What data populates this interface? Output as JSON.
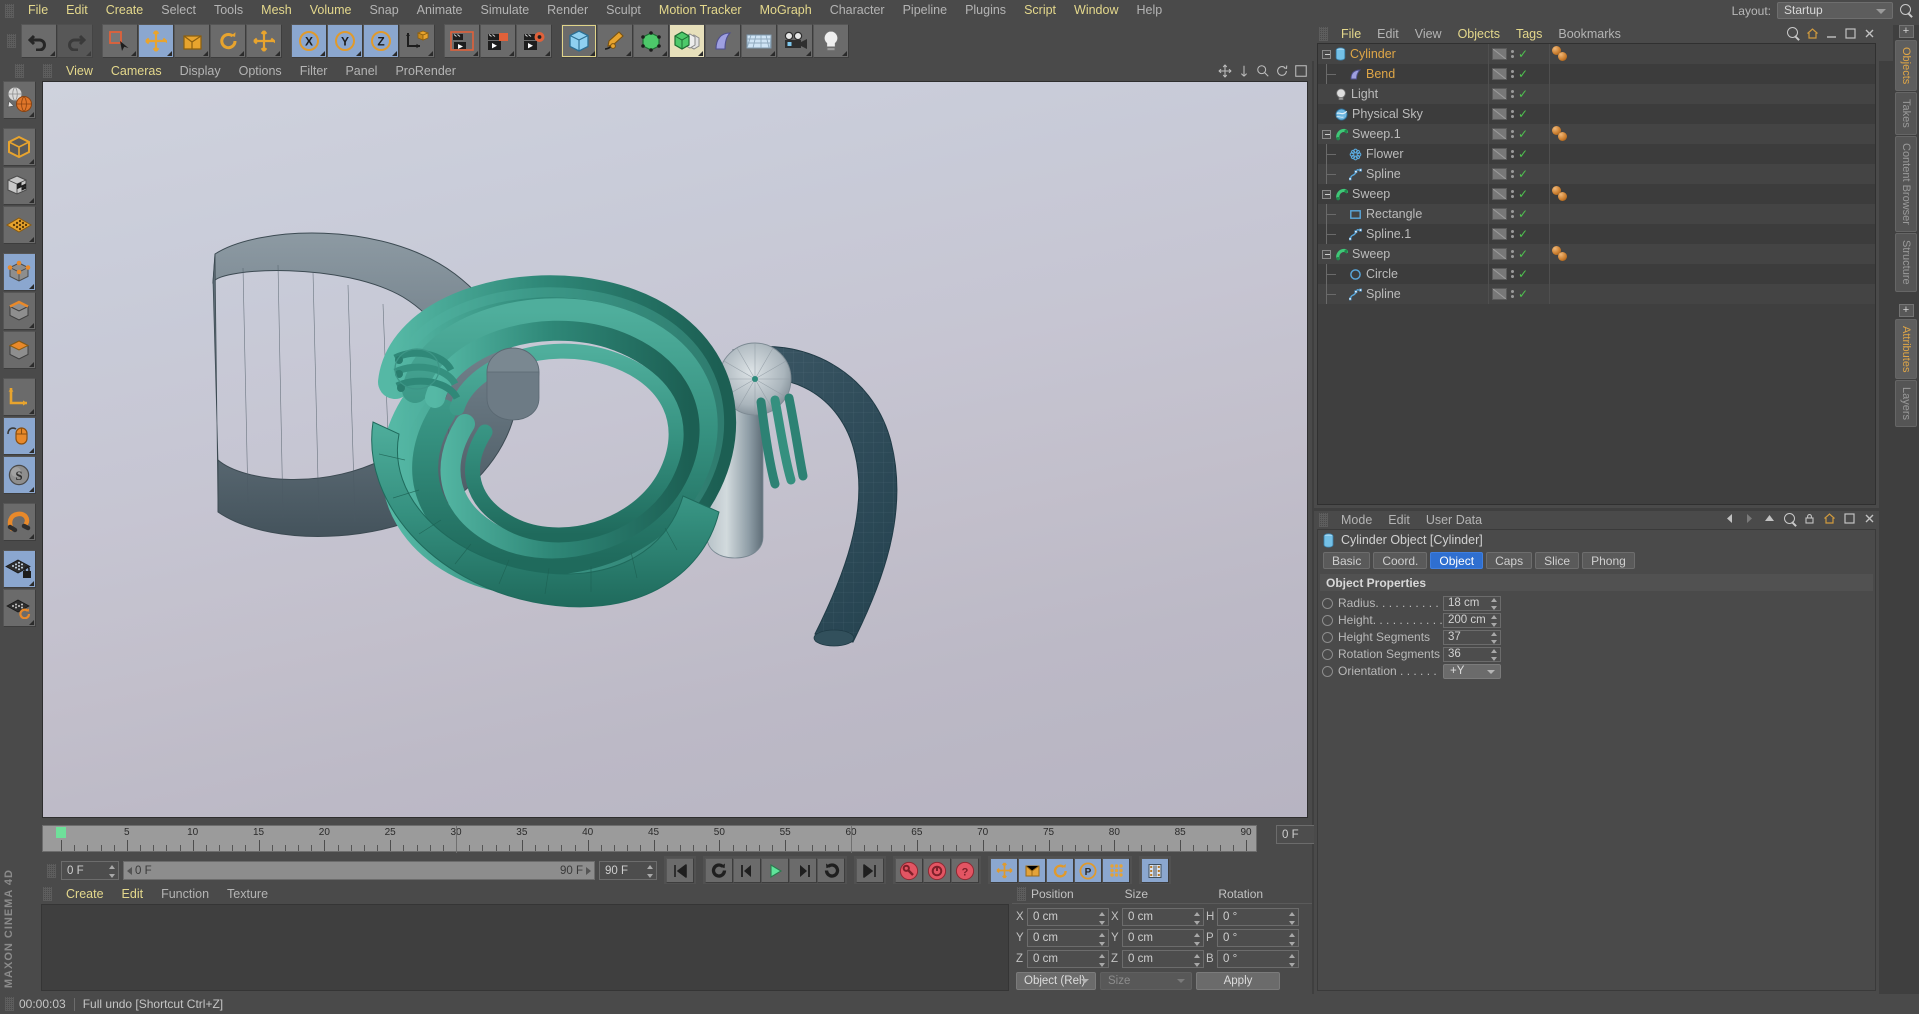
{
  "app": {
    "title": "MAXON CINEMA 4D",
    "brand_line1": "MAXON",
    "brand_line2": "CINEMA 4D"
  },
  "menubar": {
    "items": [
      {
        "label": "File",
        "highlight": true
      },
      {
        "label": "Edit",
        "highlight": true
      },
      {
        "label": "Create",
        "highlight": true
      },
      {
        "label": "Select",
        "highlight": false
      },
      {
        "label": "Tools",
        "highlight": false
      },
      {
        "label": "Mesh",
        "highlight": true
      },
      {
        "label": "Volume",
        "highlight": true
      },
      {
        "label": "Snap",
        "highlight": false
      },
      {
        "label": "Animate",
        "highlight": false
      },
      {
        "label": "Simulate",
        "highlight": false
      },
      {
        "label": "Render",
        "highlight": false
      },
      {
        "label": "Sculpt",
        "highlight": false
      },
      {
        "label": "Motion Tracker",
        "highlight": true
      },
      {
        "label": "MoGraph",
        "highlight": true
      },
      {
        "label": "Character",
        "highlight": false
      },
      {
        "label": "Pipeline",
        "highlight": false
      },
      {
        "label": "Plugins",
        "highlight": false
      },
      {
        "label": "Script",
        "highlight": true
      },
      {
        "label": "Window",
        "highlight": true
      },
      {
        "label": "Help",
        "highlight": false
      }
    ],
    "layout_label": "Layout:",
    "layout_value": "Startup",
    "search_icon": "magnifier-icon"
  },
  "toolbar": {
    "groups": [
      {
        "buttons": [
          {
            "icon": "undo-icon",
            "state": "normal"
          },
          {
            "icon": "redo-icon",
            "state": "disabled"
          }
        ]
      },
      {
        "buttons": [
          {
            "icon": "live-selection-icon",
            "state": "normal"
          },
          {
            "icon": "move-tool-icon",
            "state": "active"
          },
          {
            "icon": "scale-tool-icon",
            "state": "normal"
          },
          {
            "icon": "rotate-tool-icon",
            "state": "normal"
          },
          {
            "icon": "move-alt-icon",
            "state": "normal"
          }
        ]
      },
      {
        "buttons": [
          {
            "icon": "axis-x-icon",
            "state": "active"
          },
          {
            "icon": "axis-y-icon",
            "state": "active"
          },
          {
            "icon": "axis-z-icon",
            "state": "active"
          },
          {
            "icon": "world-object-coordinates-icon",
            "state": "normal"
          }
        ]
      },
      {
        "buttons": [
          {
            "icon": "render-view-icon",
            "state": "normal"
          },
          {
            "icon": "render-region-icon",
            "state": "normal"
          },
          {
            "icon": "render-settings-icon",
            "state": "normal"
          }
        ]
      },
      {
        "buttons": [
          {
            "icon": "cube-primitive-icon",
            "state": "selected"
          },
          {
            "icon": "spline-pen-icon",
            "state": "normal"
          },
          {
            "icon": "generator-nurbs-icon",
            "state": "normal"
          },
          {
            "icon": "array-cloner-icon",
            "state": "cream"
          },
          {
            "icon": "deformer-bend-icon",
            "state": "normal"
          },
          {
            "icon": "environment-floor-icon",
            "state": "normal"
          },
          {
            "icon": "camera-icon",
            "state": "normal"
          },
          {
            "icon": "light-icon",
            "state": "normal"
          }
        ]
      }
    ]
  },
  "left_toolbar": {
    "buttons": [
      {
        "icon": "undo-view-globe-icon",
        "state": "normal"
      },
      {
        "icon": "model-mode-icon",
        "state": "normal"
      },
      {
        "icon": "texture-mode-icon",
        "state": "normal"
      },
      {
        "icon": "workplane-mode-icon",
        "state": "normal"
      },
      {
        "icon": "points-mode-icon",
        "state": "active"
      },
      {
        "icon": "edges-mode-icon",
        "state": "normal"
      },
      {
        "icon": "polygons-mode-icon",
        "state": "normal"
      },
      {
        "icon": "axis-modify-icon",
        "state": "normal"
      },
      {
        "icon": "viewport-solo-mouse-icon",
        "state": "active"
      },
      {
        "icon": "soft-selection-icon",
        "state": "active"
      },
      {
        "icon": "magnet-icon",
        "state": "normal"
      },
      {
        "icon": "workplane-lock-icon",
        "state": "active"
      },
      {
        "icon": "workplane-rotate-icon",
        "state": "normal"
      }
    ]
  },
  "viewport": {
    "menu": [
      {
        "label": "View",
        "highlight": true
      },
      {
        "label": "Cameras",
        "highlight": true
      },
      {
        "label": "Display",
        "highlight": false
      },
      {
        "label": "Options",
        "highlight": false
      },
      {
        "label": "Filter",
        "highlight": false
      },
      {
        "label": "Panel",
        "highlight": false
      },
      {
        "label": "ProRender",
        "highlight": false
      }
    ],
    "corner_icons": [
      "pan-icon",
      "dolly-icon",
      "zoom-icon",
      "rotate-icon",
      "maximize-icon"
    ]
  },
  "timeline": {
    "ruler": {
      "min": 0,
      "max": 90,
      "label_step": 5,
      "labels": [
        0,
        5,
        10,
        15,
        20,
        25,
        30,
        35,
        40,
        45,
        50,
        55,
        60,
        65,
        70,
        75,
        80,
        85,
        90
      ],
      "playhead_frame": 0
    },
    "current_frame_field": "0 F",
    "start_field": "0 F",
    "range_start": "0 F",
    "range_end": "90 F",
    "end_field": "90 F",
    "buttons": [
      {
        "icon": "go-to-start-icon",
        "state": "normal"
      },
      {
        "icon": "play-backwards-loop-icon",
        "state": "normal"
      },
      {
        "icon": "previous-frame-icon",
        "state": "normal"
      },
      {
        "icon": "play-forward-icon",
        "state": "normal"
      },
      {
        "icon": "next-frame-icon",
        "state": "normal"
      },
      {
        "icon": "play-forward-loop-icon",
        "state": "normal"
      },
      {
        "icon": "go-to-end-icon",
        "state": "normal"
      },
      {
        "icon": "record-key-icon",
        "state": "normal"
      },
      {
        "icon": "autokeying-icon",
        "state": "normal"
      },
      {
        "icon": "keyframe-selection-icon",
        "state": "normal"
      },
      {
        "icon": "position-key-icon",
        "state": "active"
      },
      {
        "icon": "scale-key-icon",
        "state": "active"
      },
      {
        "icon": "rotation-key-icon",
        "state": "active"
      },
      {
        "icon": "parameter-key-icon",
        "state": "active"
      },
      {
        "icon": "point-level-animation-icon",
        "state": "active"
      },
      {
        "icon": "timeline-window-icon",
        "state": "active"
      }
    ]
  },
  "material_manager": {
    "menu": [
      {
        "label": "Create",
        "highlight": true
      },
      {
        "label": "Edit",
        "highlight": true
      },
      {
        "label": "Function",
        "highlight": false
      },
      {
        "label": "Texture",
        "highlight": false
      }
    ],
    "materials": []
  },
  "coordinates": {
    "headers": [
      "Position",
      "Size",
      "Rotation"
    ],
    "rows": [
      {
        "pos_axis": "X",
        "pos_value": "0 cm",
        "size_axis": "X",
        "size_value": "0 cm",
        "rot_axis": "H",
        "rot_value": "0 °"
      },
      {
        "pos_axis": "Y",
        "pos_value": "0 cm",
        "size_axis": "Y",
        "size_value": "0 cm",
        "rot_axis": "P",
        "rot_value": "0 °"
      },
      {
        "pos_axis": "Z",
        "pos_value": "0 cm",
        "size_axis": "Z",
        "size_value": "0 cm",
        "rot_axis": "B",
        "rot_value": "0 °"
      }
    ],
    "mode_dropdown": "Object (Rel)",
    "size_dropdown": "Size",
    "apply_button": "Apply"
  },
  "object_manager": {
    "menu": [
      {
        "label": "File",
        "highlight": true
      },
      {
        "label": "Edit",
        "highlight": false
      },
      {
        "label": "View",
        "highlight": false
      },
      {
        "label": "Objects",
        "highlight": true
      },
      {
        "label": "Tags",
        "highlight": true
      },
      {
        "label": "Bookmarks",
        "highlight": false
      }
    ],
    "objects": [
      {
        "name": "Cylinder",
        "icon": "cylinder-icon",
        "depth": 0,
        "color": "orange",
        "expander": true,
        "materials": 2
      },
      {
        "name": "Bend",
        "icon": "bend-deformer-icon",
        "depth": 1,
        "color": "orange",
        "expander": false,
        "materials": 0
      },
      {
        "name": "Light",
        "icon": "light-icon",
        "depth": 0,
        "color": "gray",
        "expander": false,
        "materials": 0
      },
      {
        "name": "Physical Sky",
        "icon": "physical-sky-icon",
        "depth": 0,
        "color": "gray",
        "expander": false,
        "materials": 0
      },
      {
        "name": "Sweep.1",
        "icon": "sweep-icon",
        "depth": 0,
        "color": "gray",
        "expander": true,
        "materials": 2
      },
      {
        "name": "Flower",
        "icon": "flower-spline-icon",
        "depth": 1,
        "color": "gray",
        "expander": false,
        "materials": 0
      },
      {
        "name": "Spline",
        "icon": "spline-icon",
        "depth": 1,
        "color": "gray",
        "expander": false,
        "materials": 0
      },
      {
        "name": "Sweep",
        "icon": "sweep-icon",
        "depth": 0,
        "color": "gray",
        "expander": true,
        "materials": 2
      },
      {
        "name": "Rectangle",
        "icon": "rectangle-spline-icon",
        "depth": 1,
        "color": "gray",
        "expander": false,
        "materials": 0
      },
      {
        "name": "Spline.1",
        "icon": "spline-icon",
        "depth": 1,
        "color": "gray",
        "expander": false,
        "materials": 0
      },
      {
        "name": "Sweep",
        "icon": "sweep-icon",
        "depth": 0,
        "color": "gray",
        "expander": true,
        "materials": 2
      },
      {
        "name": "Circle",
        "icon": "circle-spline-icon",
        "depth": 1,
        "color": "gray",
        "expander": false,
        "materials": 0
      },
      {
        "name": "Spline",
        "icon": "spline-icon",
        "depth": 1,
        "color": "gray",
        "expander": false,
        "materials": 0
      }
    ]
  },
  "attribute_manager": {
    "menu": [
      {
        "label": "Mode",
        "highlight": false
      },
      {
        "label": "Edit",
        "highlight": false
      },
      {
        "label": "User Data",
        "highlight": false
      }
    ],
    "object_title": "Cylinder Object [Cylinder]",
    "object_icon": "cylinder-icon",
    "tabs": [
      {
        "label": "Basic",
        "selected": false
      },
      {
        "label": "Coord.",
        "selected": false
      },
      {
        "label": "Object",
        "selected": true
      },
      {
        "label": "Caps",
        "selected": false
      },
      {
        "label": "Slice",
        "selected": false
      },
      {
        "label": "Phong",
        "selected": false
      }
    ],
    "section_title": "Object Properties",
    "properties": [
      {
        "label": "Radius. . . . . . . . . . .",
        "value": "18 cm",
        "type": "number"
      },
      {
        "label": "Height. . . . . . . . . . .",
        "value": "200 cm",
        "type": "number"
      },
      {
        "label": "Height Segments",
        "value": "37",
        "type": "number"
      },
      {
        "label": "Rotation Segments",
        "value": "36",
        "type": "number"
      },
      {
        "label": "Orientation . . . . . .",
        "value": "+Y",
        "type": "dropdown"
      }
    ]
  },
  "vertical_tabs": {
    "top": [
      {
        "label": "Objects",
        "selected": true
      },
      {
        "label": "Takes",
        "selected": false
      },
      {
        "label": "Content Browser",
        "selected": false
      },
      {
        "label": "Structure",
        "selected": false
      }
    ],
    "bottom": [
      {
        "label": "Attributes",
        "selected": true
      },
      {
        "label": "Layers",
        "selected": false
      }
    ]
  },
  "statusbar": {
    "time": "00:00:03",
    "message": "Full undo [Shortcut Ctrl+Z]"
  },
  "colors": {
    "accent_orange": "#dfa647",
    "accent_blue": "#2f6fd0",
    "panel_bg": "#4a4a4a",
    "list_bg": "#3f3f3f",
    "teal_mesh": "#3f9e8e",
    "slate_mesh": "#6f7f88"
  }
}
